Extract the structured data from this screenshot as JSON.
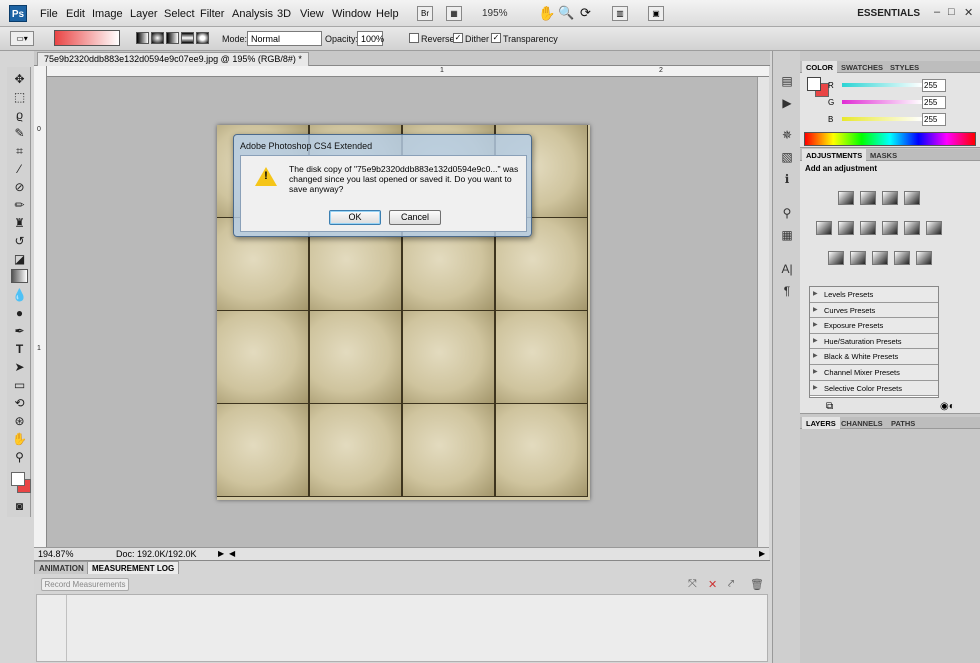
{
  "app": {
    "logo": "Ps"
  },
  "menu": [
    "File",
    "Edit",
    "Image",
    "Layer",
    "Select",
    "Filter",
    "Analysis",
    "3D",
    "View",
    "Window",
    "Help"
  ],
  "app_bar": {
    "bridge": "Br",
    "zoom": "195%",
    "workspace": "ESSENTIALS"
  },
  "window_controls": [
    "–",
    "□",
    "✕"
  ],
  "options": {
    "mode_label": "Mode:",
    "mode_value": "Normal",
    "opacity_label": "Opacity:",
    "opacity_value": "100%",
    "reverse_label": "Reverse",
    "reverse_checked": false,
    "dither_label": "Dither",
    "dither_checked": true,
    "transparency_label": "Transparency",
    "transparency_checked": true,
    "colors": {
      "gradient_start": "#e94545",
      "gradient_end": "#ffffff"
    }
  },
  "document": {
    "tab_title": "75e9b2320ddb883e132d0594e9c07ee9.jpg @ 195% (RGB/8#) *",
    "ruler_top": [
      "1",
      "2"
    ],
    "ruler_left": [
      "0",
      "1"
    ]
  },
  "status": {
    "zoom": "194.87%",
    "doc": "Doc: 192.0K/192.0K"
  },
  "bottom_panel": {
    "tabs": [
      "ANIMATION",
      "MEASUREMENT LOG"
    ],
    "active_tab": "MEASUREMENT LOG",
    "record_button": "Record Measurements"
  },
  "color_panel": {
    "tabs": [
      "COLOR",
      "SWATCHES",
      "STYLES"
    ],
    "channels": [
      {
        "label": "R",
        "value": "255",
        "color": "#2ad4d4"
      },
      {
        "label": "G",
        "value": "255",
        "color": "#e02cd4"
      },
      {
        "label": "B",
        "value": "255",
        "color": "#e8e82c"
      }
    ]
  },
  "adjustments_panel": {
    "tabs": [
      "ADJUSTMENTS",
      "MASKS"
    ],
    "title": "Add an adjustment",
    "presets": [
      "Levels Presets",
      "Curves Presets",
      "Exposure Presets",
      "Hue/Saturation Presets",
      "Black & White Presets",
      "Channel Mixer Presets",
      "Selective Color Presets"
    ]
  },
  "layers_panel": {
    "tabs": [
      "LAYERS",
      "CHANNELS",
      "PATHS"
    ]
  },
  "dialog": {
    "title": "Adobe Photoshop CS4 Extended",
    "message": "The disk copy of \"75e9b2320ddb883e132d0594e9c0...\" was changed since you last opened or saved it.  Do you want to save anyway?",
    "ok": "OK",
    "cancel": "Cancel"
  }
}
